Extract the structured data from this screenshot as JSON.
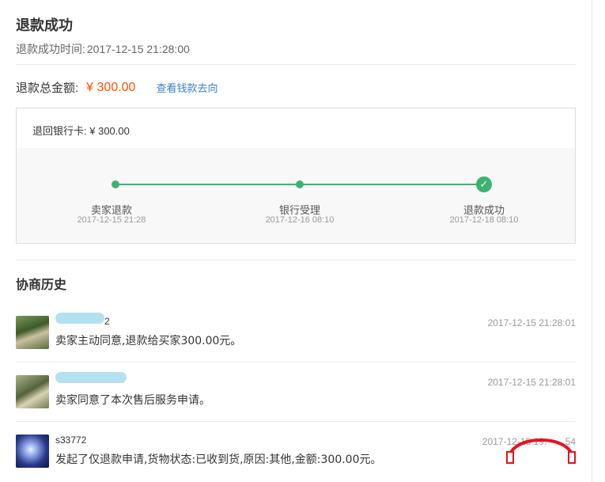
{
  "header": {
    "title": "退款成功",
    "time_label": "退款成功时间:",
    "time_value": "2017-12-15 21:28:00"
  },
  "summary": {
    "total_label": "退款总金额:",
    "total_amount": "¥ 300.00",
    "trace_link": "查看钱款去向",
    "accent_color": "#ff5000",
    "link_color": "#3a7fc4"
  },
  "refund_box": {
    "bank_label": "退回银行卡:",
    "bank_amount": "¥ 300.00",
    "progress_color": "#3cb370",
    "steps": [
      {
        "label": "卖家退款",
        "time": "2017-12-15 21:28",
        "icon": "dot"
      },
      {
        "label": "银行受理",
        "time": "2017-12-16 08:10",
        "icon": "dot"
      },
      {
        "label": "退款成功",
        "time": "2017-12-18 08:10",
        "icon": "check-icon"
      }
    ]
  },
  "history": {
    "title": "协商历史",
    "entries": [
      {
        "name": "2",
        "time": "2017-12-15 21:28:01",
        "message": "卖家主动同意,退款给买家300.00元。"
      },
      {
        "name": "",
        "time": "2017-12-15 21:28:01",
        "message": "卖家同意了本次售后服务申请。"
      },
      {
        "name": "s33772",
        "time": "2017-12-15 19:",
        "time_tail": "54",
        "message": "发起了仅退款申请,货物状态:已收到货,原因:其他,金额:300.00元。"
      }
    ]
  },
  "overlay": {
    "icon": "headset-icon",
    "color": "#e8121e"
  }
}
